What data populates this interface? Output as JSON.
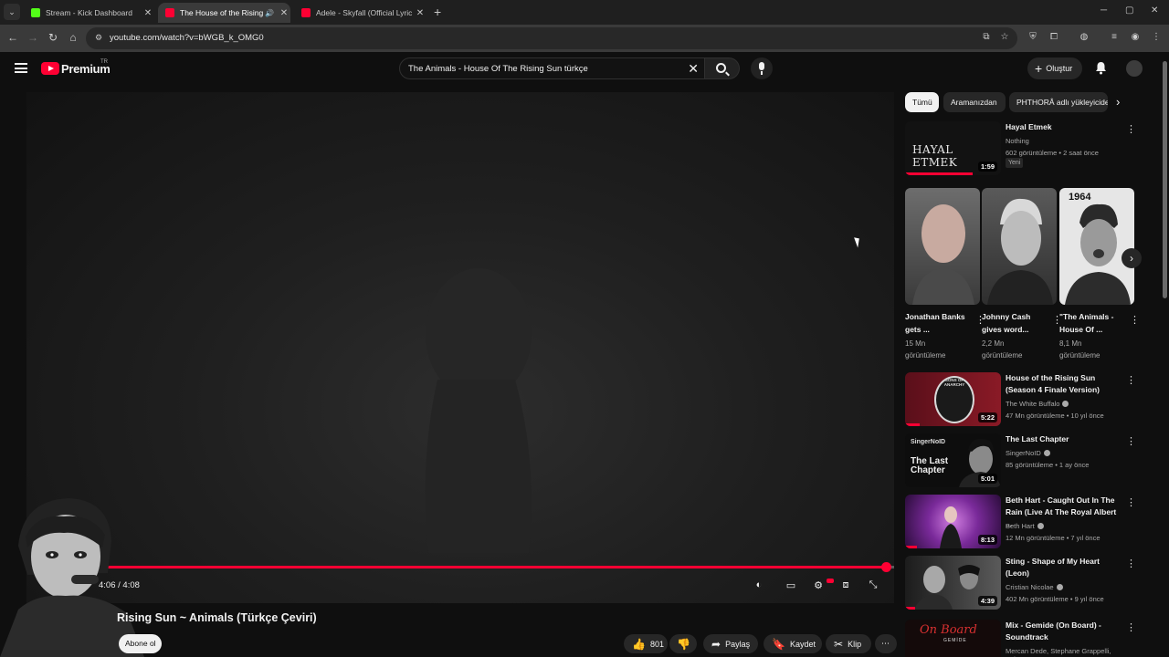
{
  "browser": {
    "tabs": [
      {
        "title": "Stream - Kick Dashboard",
        "color": "#53fc18"
      },
      {
        "title": "The House of the Rising Su",
        "color": "#ff0033"
      },
      {
        "title": "Adele - Skyfall (Official Lyric Vi",
        "color": "#ff0033"
      }
    ],
    "url": "youtube.com/watch?v=bWGB_k_OMG0"
  },
  "youtube": {
    "brand": "Premium",
    "country_code": "TR",
    "search_query": "The Animals - House Of The Rising Sun türkçe",
    "create_label": "Oluştur"
  },
  "player": {
    "time": "4:06 / 4:08",
    "progress": 0.992,
    "title": "Rising Sun ~ Animals (Türkçe Çeviri)",
    "subscribe_label": "Abone ol",
    "likes": "801",
    "share_label": "Paylaş",
    "save_label": "Kaydet",
    "clip_label": "Klip"
  },
  "chips": [
    "Tümü",
    "Aramanızdan",
    "PHTHORÂ adlı yükleyiciden"
  ],
  "recs": [
    {
      "title": "Hayal Etmek",
      "channel": "Nothing",
      "meta": "602 görüntüleme • 2 saat önce",
      "badge": "Yeni",
      "duration": "1:59",
      "thumb_text": "HAYAL ETMEK",
      "watched": 0.7
    },
    {
      "title": "House of the Rising Sun (Season 4 Finale Version)",
      "channel": "The White Buffalo",
      "meta": "47 Mn görüntüleme • 10 yıl önce",
      "duration": "5:22",
      "thumb_text": "SONS OF ANARCHY",
      "watched": 0.15
    },
    {
      "title": "The Last Chapter",
      "channel": "SingerNoID",
      "meta": "85 görüntüleme • 1 ay önce",
      "duration": "5:01",
      "thumb_text": "The Last Chapter",
      "thumb_tag": "SingerNoID",
      "watched": 0
    },
    {
      "title": "Beth Hart - Caught Out In The Rain (Live At The Royal Albert ...",
      "channel": "Beth Hart",
      "meta": "12 Mn görüntüleme • 7 yıl önce",
      "duration": "8:13",
      "watched": 0.12
    },
    {
      "title": "Sting - Shape of My Heart (Leon)",
      "channel": "Cristian Nicolae",
      "meta": "402 Mn görüntüleme • 9 yıl önce",
      "duration": "4:39",
      "watched": 0.1
    },
    {
      "title": "Mix - Gemide (On Board) - Soundtrack",
      "channel": "Mercan Dede, Stephane Grappelli, Balmo...",
      "thumb_text": "On Board",
      "thumb_sub": "GEMİDE"
    }
  ],
  "shorts": [
    {
      "title": "Jonathan Banks gets ...",
      "views": "15 Mn",
      "views_label": "görüntüleme"
    },
    {
      "title": "Johnny Cash gives word...",
      "views": "2,2 Mn",
      "views_label": "görüntüleme"
    },
    {
      "title": "\"The Animals - House Of ...",
      "views": "8,1 Mn",
      "views_label": "görüntüleme",
      "thumb_text": "1964"
    }
  ]
}
